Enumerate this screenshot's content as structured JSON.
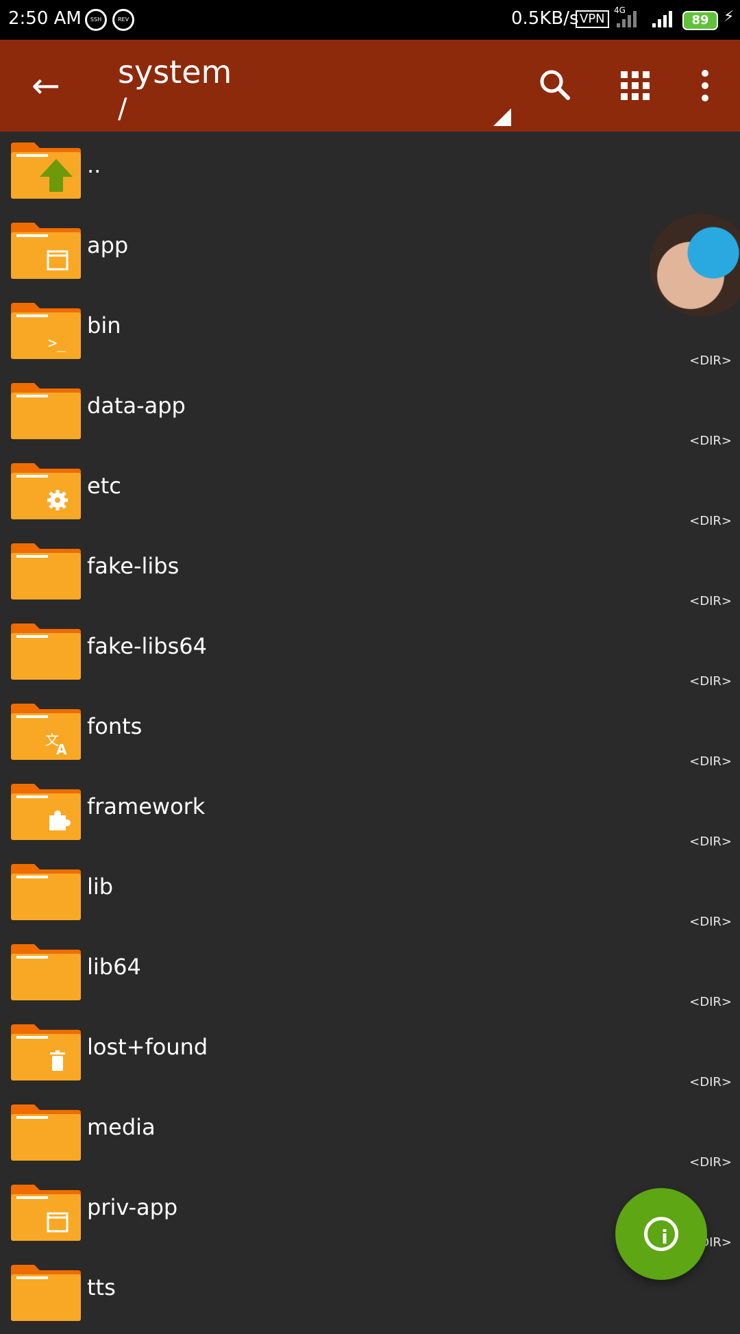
{
  "status_bar": {
    "time": "2:50 AM",
    "icon1": "SSH",
    "icon2": "REV",
    "speed": "0.5KB/s",
    "vpn": "VPN",
    "network": "4G",
    "battery": "89"
  },
  "app_bar": {
    "title": "system",
    "path": "/",
    "back_icon": "arrow-left-icon",
    "search_icon": "search-icon",
    "grid_icon": "grid-view-icon",
    "more_icon": "more-vertical-icon"
  },
  "files": [
    {
      "name": "..",
      "type": "",
      "icon": "folder-up-icon"
    },
    {
      "name": "app",
      "type": "",
      "icon": "folder-app-icon"
    },
    {
      "name": "bin",
      "type": "<DIR>",
      "icon": "folder-terminal-icon"
    },
    {
      "name": "data-app",
      "type": "<DIR>",
      "icon": "folder-icon"
    },
    {
      "name": "etc",
      "type": "<DIR>",
      "icon": "folder-gear-icon"
    },
    {
      "name": "fake-libs",
      "type": "<DIR>",
      "icon": "folder-icon"
    },
    {
      "name": "fake-libs64",
      "type": "<DIR>",
      "icon": "folder-icon"
    },
    {
      "name": "fonts",
      "type": "<DIR>",
      "icon": "folder-translate-icon"
    },
    {
      "name": "framework",
      "type": "<DIR>",
      "icon": "folder-puzzle-icon"
    },
    {
      "name": "lib",
      "type": "<DIR>",
      "icon": "folder-icon"
    },
    {
      "name": "lib64",
      "type": "<DIR>",
      "icon": "folder-icon"
    },
    {
      "name": "lost+found",
      "type": "<DIR>",
      "icon": "folder-trash-icon"
    },
    {
      "name": "media",
      "type": "<DIR>",
      "icon": "folder-icon"
    },
    {
      "name": "priv-app",
      "type": "<DIR>",
      "icon": "folder-app-icon"
    },
    {
      "name": "tts",
      "type": "",
      "icon": "folder-icon"
    }
  ],
  "fab_icon": "info-icon",
  "colors": {
    "app_bar": "#8e2a0c",
    "background": "#2a2a2a",
    "folder": "#f9a825",
    "folder_tab": "#ef6c00",
    "fab": "#5ea614"
  }
}
